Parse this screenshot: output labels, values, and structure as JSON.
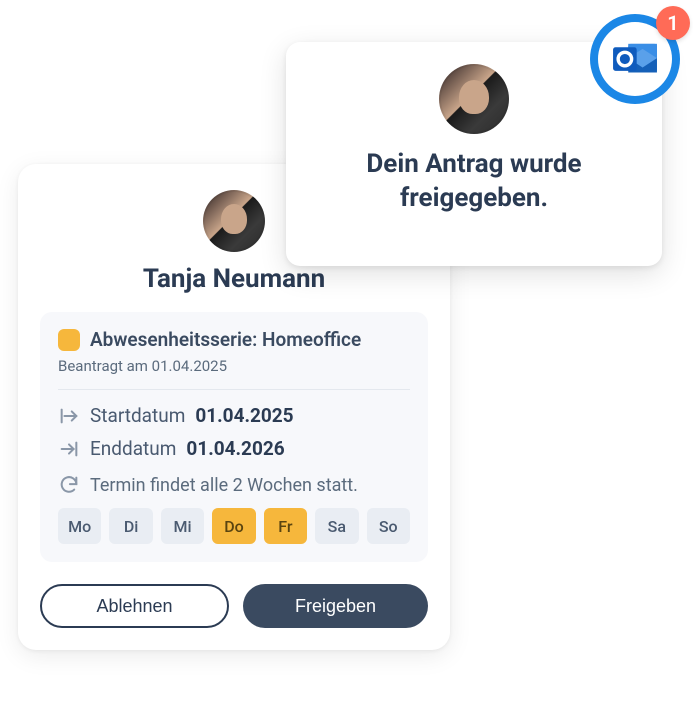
{
  "person": {
    "name": "Tanja Neumann"
  },
  "series": {
    "title": "Abwesenheitsserie: Homeoffice",
    "requested_label": "Beantragt am 01.04.2025",
    "start_label": "Startdatum",
    "start_value": "01.04.2025",
    "end_label": "Enddatum",
    "end_value": "01.04.2026",
    "recurrence_text": "Termin findet alle 2 Wochen statt."
  },
  "days": [
    {
      "label": "Mo",
      "active": false
    },
    {
      "label": "Di",
      "active": false
    },
    {
      "label": "Mi",
      "active": false
    },
    {
      "label": "Do",
      "active": true
    },
    {
      "label": "Fr",
      "active": true
    },
    {
      "label": "Sa",
      "active": false
    },
    {
      "label": "So",
      "active": false
    }
  ],
  "actions": {
    "reject_label": "Ablehnen",
    "approve_label": "Freigeben"
  },
  "notification": {
    "line1": "Dein Antrag wurde",
    "line2": "freigegeben.",
    "badge_count": "1"
  }
}
